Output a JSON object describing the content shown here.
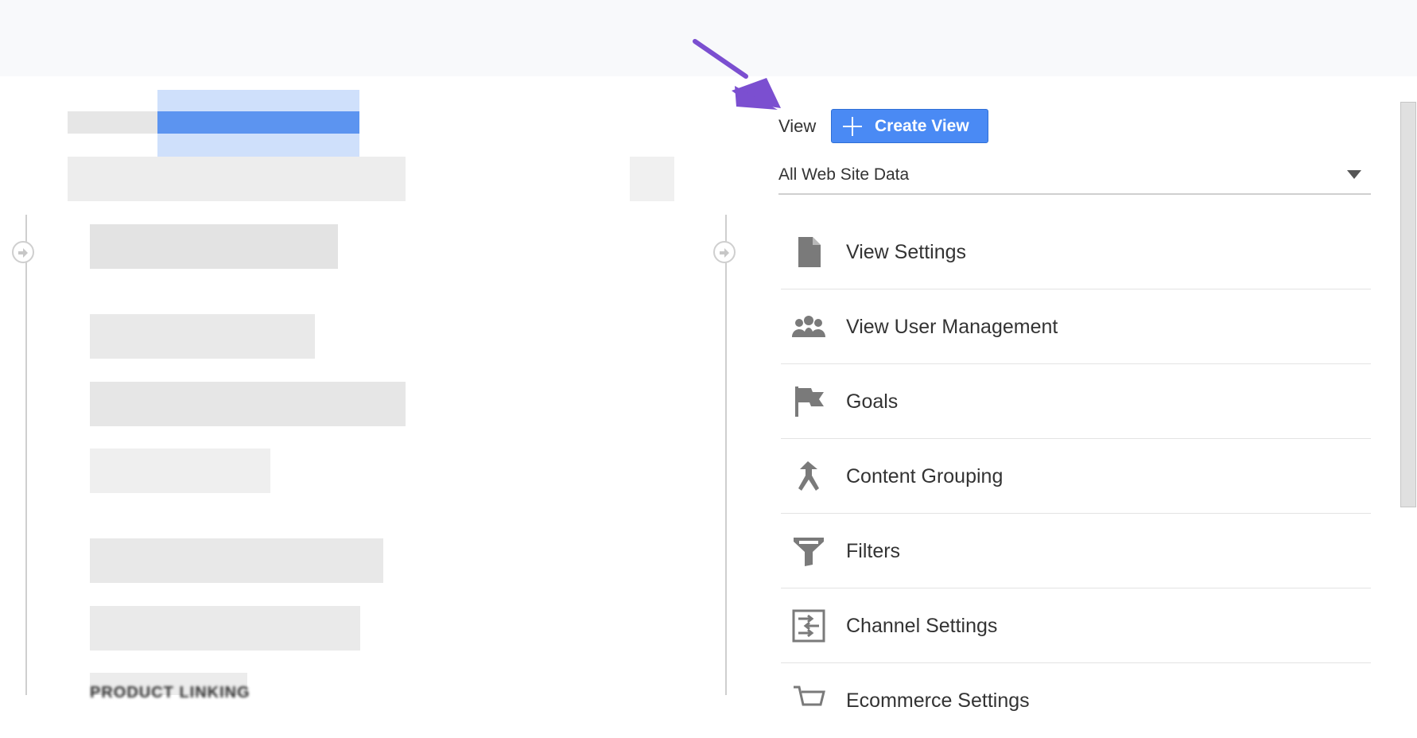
{
  "view": {
    "label": "View",
    "create_button": "Create View",
    "selected": "All Web Site Data"
  },
  "menu": [
    {
      "label": "View Settings",
      "icon": "document-icon"
    },
    {
      "label": "View User Management",
      "icon": "users-icon"
    },
    {
      "label": "Goals",
      "icon": "flag-icon"
    },
    {
      "label": "Content Grouping",
      "icon": "grouping-icon"
    },
    {
      "label": "Filters",
      "icon": "filter-icon"
    },
    {
      "label": "Channel Settings",
      "icon": "channel-settings-icon"
    },
    {
      "label": "Ecommerce Settings",
      "icon": "cart-icon"
    }
  ],
  "left": {
    "section_heading": "PRODUCT LINKING"
  },
  "colors": {
    "accent": "#4a8af4",
    "annotation": "#7b4fd0",
    "icon": "#7a7a7a"
  }
}
